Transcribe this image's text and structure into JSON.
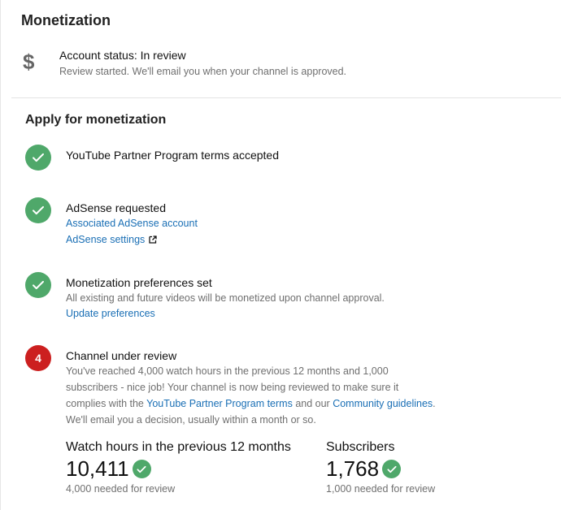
{
  "monetization": {
    "title": "Monetization",
    "status_icon": "dollar-icon",
    "status_symbol": "$",
    "status_title": "Account status: In review",
    "status_sub": "Review started. We'll email you when your channel is approved."
  },
  "apply": {
    "title": "Apply for monetization",
    "steps": [
      {
        "title": "YouTube Partner Program terms accepted",
        "state": "done"
      },
      {
        "title": "AdSense requested",
        "state": "done",
        "links": [
          "Associated AdSense account",
          "AdSense settings"
        ]
      },
      {
        "title": "Monetization preferences set",
        "state": "done",
        "text": "All existing and future videos will be monetized upon channel approval.",
        "links": [
          "Update preferences"
        ]
      },
      {
        "title": "Channel under review",
        "state": "pending",
        "number": "4",
        "text_line1": "You've reached 4,000 watch hours in the previous 12 months and 1,000",
        "text_line2": "subscribers - nice job! Your channel is now being reviewed to make sure it",
        "text_line3_pre": "complies with the ",
        "text_line3_link1": "YouTube Partner Program terms",
        "text_line3_mid": " and our ",
        "text_line3_link2": "Community guidelines",
        "text_line3_post": ".",
        "text_line4": "We'll email you a decision, usually within a month or so."
      }
    ]
  },
  "metrics": {
    "watch_hours": {
      "label": "Watch hours in the previous 12 months",
      "value": "10,411",
      "needed": "4,000 needed for review"
    },
    "subscribers": {
      "label": "Subscribers",
      "value": "1,768",
      "needed": "1,000 needed for review"
    }
  },
  "colors": {
    "success": "#4fa86a",
    "pending": "#cc1f1f",
    "link": "#1a6fb5"
  }
}
